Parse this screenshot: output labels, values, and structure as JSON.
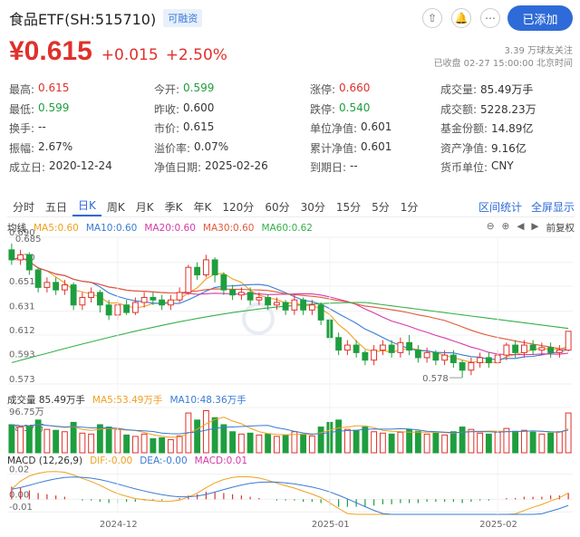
{
  "header": {
    "title": "食品ETF(SH:515710)",
    "badge": "可融资",
    "add_label": "已添加"
  },
  "quote": {
    "price": "¥0.615",
    "change": "+0.015",
    "change_pct": "+2.50%",
    "followers": "3.39 万球友关注",
    "status": "已收盘 02-27 15:00:00 北京时间"
  },
  "stats": [
    [
      {
        "k": "最高:",
        "v": "0.615",
        "c": "red"
      },
      {
        "k": "今开:",
        "v": "0.599",
        "c": "green"
      },
      {
        "k": "涨停:",
        "v": "0.660",
        "c": "red"
      },
      {
        "k": "成交量:",
        "v": "85.49万手",
        "c": ""
      }
    ],
    [
      {
        "k": "最低:",
        "v": "0.599",
        "c": "green"
      },
      {
        "k": "昨收:",
        "v": "0.600",
        "c": ""
      },
      {
        "k": "跌停:",
        "v": "0.540",
        "c": "green"
      },
      {
        "k": "成交额:",
        "v": "5228.23万",
        "c": ""
      }
    ],
    [
      {
        "k": "换手:",
        "v": "--",
        "c": ""
      },
      {
        "k": "市价:",
        "v": "0.615",
        "c": ""
      },
      {
        "k": "单位净值:",
        "v": "0.601",
        "c": ""
      },
      {
        "k": "基金份额:",
        "v": "14.89亿",
        "c": ""
      }
    ],
    [
      {
        "k": "振幅:",
        "v": "2.67%",
        "c": ""
      },
      {
        "k": "溢价率:",
        "v": "0.07%",
        "c": ""
      },
      {
        "k": "累计净值:",
        "v": "0.601",
        "c": ""
      },
      {
        "k": "资产净值:",
        "v": "9.16亿",
        "c": ""
      }
    ],
    [
      {
        "k": "成立日:",
        "v": "2020-12-24",
        "c": ""
      },
      {
        "k": "净值日期:",
        "v": "2025-02-26",
        "c": ""
      },
      {
        "k": "到期日:",
        "v": "--",
        "c": ""
      },
      {
        "k": "货币单位:",
        "v": "CNY",
        "c": ""
      }
    ]
  ],
  "tabs": [
    "分时",
    "五日",
    "日K",
    "周K",
    "月K",
    "季K",
    "年K",
    "120分",
    "60分",
    "30分",
    "15分",
    "5分",
    "1分"
  ],
  "active_tab": "日K",
  "tab_links": [
    "区间统计",
    "全屏显示"
  ],
  "ma_legend": [
    {
      "label": "均线",
      "color": "#333333"
    },
    {
      "label": "MA5:0.60",
      "color": "#f0a020"
    },
    {
      "label": "MA10:0.60",
      "color": "#3a7bd5"
    },
    {
      "label": "MA20:0.60",
      "color": "#d63aa8"
    },
    {
      "label": "MA30:0.60",
      "color": "#e05a3a"
    },
    {
      "label": "MA60:0.62",
      "color": "#35b04a"
    }
  ],
  "adjust_label": "前复权",
  "vol_legend": [
    {
      "label": "成交量 85.49万手",
      "color": "#333333"
    },
    {
      "label": "MA5:53.49万手",
      "color": "#f0a020"
    },
    {
      "label": "MA10:48.36万手",
      "color": "#3a7bd5"
    }
  ],
  "macd_legend": [
    {
      "label": "MACD (12,26,9)",
      "color": "#333333"
    },
    {
      "label": "DIF:-0.00",
      "color": "#f0a020"
    },
    {
      "label": "DEA:-0.00",
      "color": "#3a7bd5"
    },
    {
      "label": "MACD:0.01",
      "color": "#d63aa8"
    }
  ],
  "chart_data": {
    "type": "candlestick",
    "price_axis": [
      "0.690",
      "0.670",
      "0.651",
      "0.631",
      "0.612",
      "0.593",
      "0.573"
    ],
    "price_range": [
      0.573,
      0.69
    ],
    "high_label": "0.685",
    "low_label": "0.578",
    "vol_axis": [
      "96.75万",
      "48.37万"
    ],
    "vol_max": 96.75,
    "macd_axis": [
      "0.02",
      "0.00",
      "-0.01"
    ],
    "macd_range": [
      -0.012,
      0.024
    ],
    "x_labels": [
      {
        "i": 12,
        "label": "2024-12"
      },
      {
        "i": 36,
        "label": "2025-01"
      },
      {
        "i": 55,
        "label": "2025-02"
      }
    ],
    "candles": [
      [
        0.68,
        0.672,
        0.685,
        0.668,
        60
      ],
      [
        0.672,
        0.676,
        0.68,
        0.668,
        55
      ],
      [
        0.676,
        0.664,
        0.678,
        0.66,
        58
      ],
      [
        0.664,
        0.65,
        0.666,
        0.646,
        70
      ],
      [
        0.65,
        0.654,
        0.658,
        0.646,
        50
      ],
      [
        0.654,
        0.648,
        0.658,
        0.644,
        48
      ],
      [
        0.648,
        0.652,
        0.656,
        0.644,
        45
      ],
      [
        0.652,
        0.636,
        0.654,
        0.632,
        65
      ],
      [
        0.636,
        0.642,
        0.646,
        0.632,
        42
      ],
      [
        0.642,
        0.646,
        0.65,
        0.638,
        40
      ],
      [
        0.646,
        0.636,
        0.648,
        0.63,
        60
      ],
      [
        0.636,
        0.628,
        0.64,
        0.624,
        55
      ],
      [
        0.628,
        0.636,
        0.64,
        0.624,
        50
      ],
      [
        0.636,
        0.63,
        0.64,
        0.628,
        38
      ],
      [
        0.63,
        0.638,
        0.642,
        0.628,
        35
      ],
      [
        0.638,
        0.642,
        0.646,
        0.634,
        40
      ],
      [
        0.642,
        0.64,
        0.646,
        0.636,
        30
      ],
      [
        0.64,
        0.636,
        0.644,
        0.632,
        32
      ],
      [
        0.636,
        0.64,
        0.644,
        0.632,
        28
      ],
      [
        0.64,
        0.646,
        0.65,
        0.638,
        36
      ],
      [
        0.646,
        0.666,
        0.668,
        0.644,
        85
      ],
      [
        0.666,
        0.66,
        0.67,
        0.656,
        70
      ],
      [
        0.66,
        0.672,
        0.676,
        0.658,
        90
      ],
      [
        0.672,
        0.66,
        0.674,
        0.654,
        75
      ],
      [
        0.66,
        0.648,
        0.662,
        0.644,
        60
      ],
      [
        0.648,
        0.644,
        0.652,
        0.64,
        45
      ],
      [
        0.644,
        0.646,
        0.65,
        0.64,
        40
      ],
      [
        0.646,
        0.64,
        0.65,
        0.636,
        42
      ],
      [
        0.64,
        0.642,
        0.646,
        0.636,
        38
      ],
      [
        0.642,
        0.636,
        0.644,
        0.632,
        40
      ],
      [
        0.636,
        0.638,
        0.642,
        0.632,
        35
      ],
      [
        0.638,
        0.632,
        0.64,
        0.628,
        38
      ],
      [
        0.632,
        0.64,
        0.644,
        0.628,
        45
      ],
      [
        0.64,
        0.632,
        0.642,
        0.628,
        40
      ],
      [
        0.632,
        0.636,
        0.64,
        0.628,
        36
      ],
      [
        0.636,
        0.624,
        0.638,
        0.62,
        55
      ],
      [
        0.624,
        0.61,
        0.626,
        0.606,
        65
      ],
      [
        0.61,
        0.6,
        0.614,
        0.596,
        70
      ],
      [
        0.6,
        0.604,
        0.608,
        0.596,
        50
      ],
      [
        0.604,
        0.598,
        0.608,
        0.594,
        48
      ],
      [
        0.598,
        0.592,
        0.6,
        0.588,
        55
      ],
      [
        0.592,
        0.6,
        0.604,
        0.588,
        45
      ],
      [
        0.6,
        0.604,
        0.608,
        0.596,
        42
      ],
      [
        0.604,
        0.598,
        0.608,
        0.594,
        40
      ],
      [
        0.598,
        0.606,
        0.61,
        0.594,
        44
      ],
      [
        0.606,
        0.6,
        0.612,
        0.596,
        50
      ],
      [
        0.6,
        0.594,
        0.604,
        0.59,
        46
      ],
      [
        0.594,
        0.598,
        0.602,
        0.59,
        40
      ],
      [
        0.598,
        0.592,
        0.6,
        0.588,
        42
      ],
      [
        0.592,
        0.596,
        0.6,
        0.588,
        38
      ],
      [
        0.596,
        0.59,
        0.6,
        0.586,
        45
      ],
      [
        0.59,
        0.584,
        0.592,
        0.578,
        55
      ],
      [
        0.584,
        0.59,
        0.594,
        0.58,
        50
      ],
      [
        0.59,
        0.594,
        0.598,
        0.586,
        42
      ],
      [
        0.594,
        0.59,
        0.598,
        0.586,
        40
      ],
      [
        0.59,
        0.596,
        0.6,
        0.588,
        44
      ],
      [
        0.596,
        0.604,
        0.606,
        0.592,
        52
      ],
      [
        0.604,
        0.598,
        0.608,
        0.594,
        46
      ],
      [
        0.598,
        0.604,
        0.608,
        0.594,
        48
      ],
      [
        0.604,
        0.6,
        0.608,
        0.596,
        44
      ],
      [
        0.6,
        0.602,
        0.606,
        0.596,
        40
      ],
      [
        0.602,
        0.598,
        0.606,
        0.594,
        42
      ],
      [
        0.598,
        0.6,
        0.604,
        0.594,
        45
      ],
      [
        0.6,
        0.615,
        0.615,
        0.599,
        85
      ]
    ],
    "macd_bars": [
      0.01,
      0.009,
      0.007,
      0.005,
      0.004,
      0.003,
      0.002,
      0.0,
      -0.001,
      -0.001,
      -0.002,
      -0.003,
      -0.003,
      -0.002,
      -0.002,
      -0.001,
      -0.001,
      -0.001,
      0.0,
      0.001,
      0.003,
      0.004,
      0.006,
      0.006,
      0.005,
      0.004,
      0.003,
      0.002,
      0.001,
      0.0,
      -0.001,
      -0.001,
      -0.001,
      -0.002,
      -0.002,
      -0.003,
      -0.005,
      -0.006,
      -0.006,
      -0.006,
      -0.006,
      -0.005,
      -0.004,
      -0.004,
      -0.003,
      -0.003,
      -0.003,
      -0.002,
      -0.002,
      -0.002,
      -0.002,
      -0.003,
      -0.002,
      -0.001,
      -0.001,
      0.0,
      0.001,
      0.001,
      0.002,
      0.002,
      0.002,
      0.003,
      0.003,
      0.005
    ]
  }
}
